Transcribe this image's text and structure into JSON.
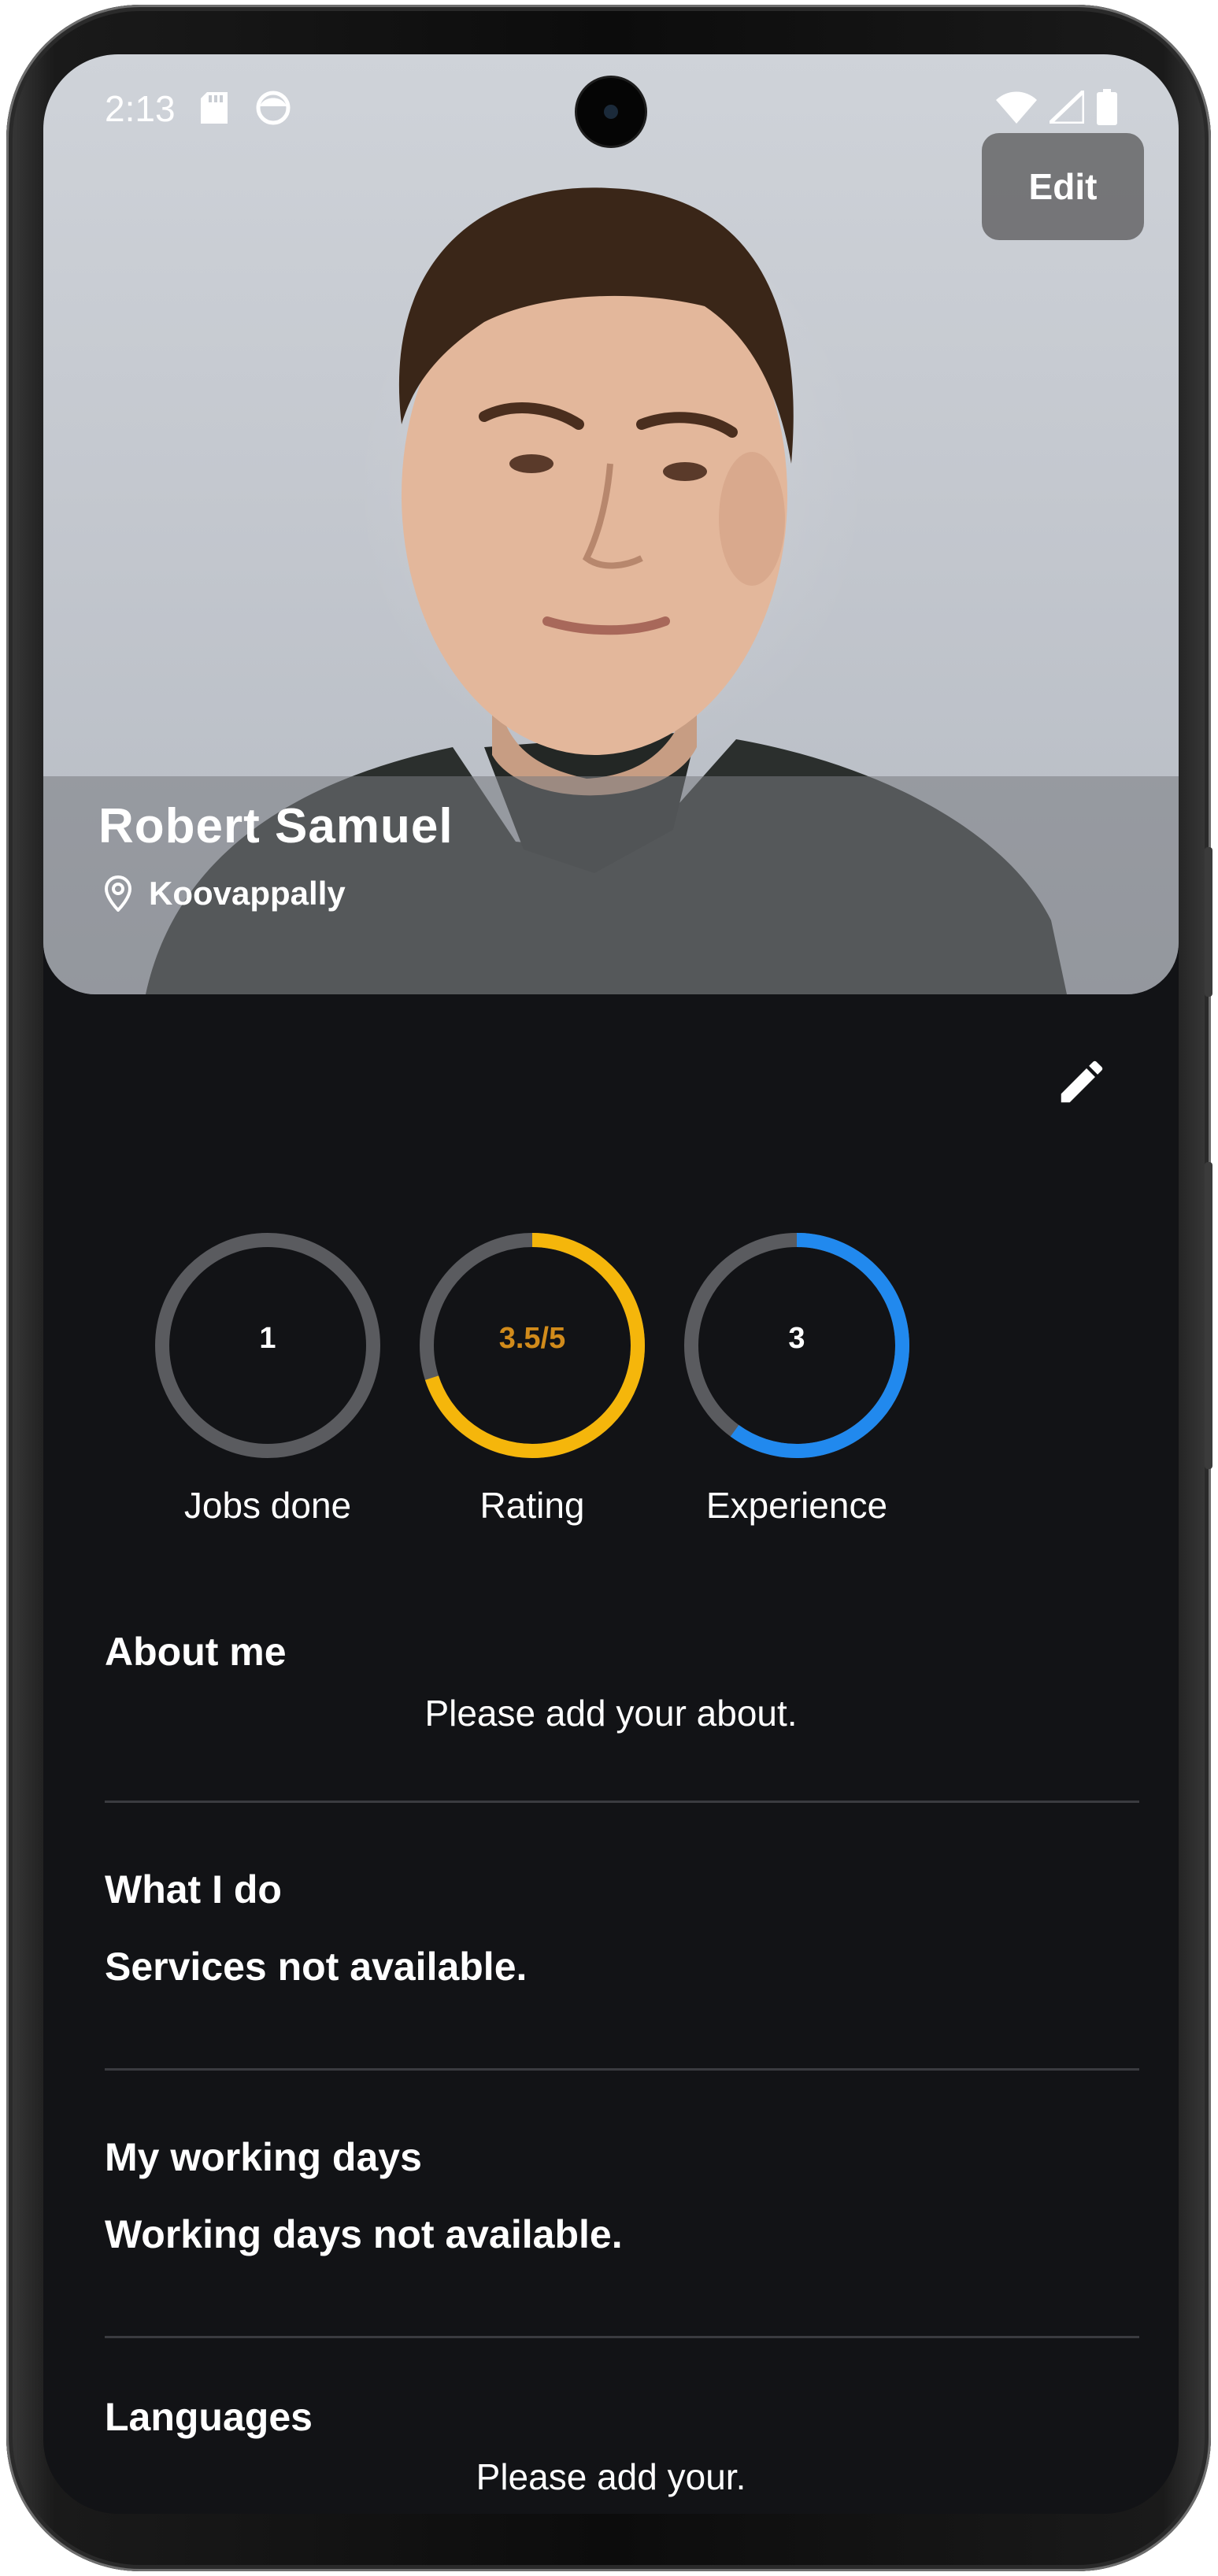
{
  "status_bar": {
    "time": "2:13",
    "icons": [
      "sd-card-icon",
      "face-icon",
      "wifi-icon",
      "signal-icon",
      "battery-icon"
    ]
  },
  "header": {
    "edit_label": "Edit",
    "name": "Robert Samuel",
    "location": "Koovappally",
    "icons": [
      "location-pin-icon",
      "pencil-icon"
    ]
  },
  "stats": [
    {
      "value": "1",
      "label": "Jobs done",
      "progress": 0.0,
      "ring_color": "#5a5b5f"
    },
    {
      "value": "3.5/5",
      "label": "Rating",
      "progress": 0.7,
      "ring_color": "#f5b60b",
      "value_color": "#d18b1b"
    },
    {
      "value": "3",
      "label": "Experience",
      "progress": 0.6,
      "ring_color": "#2189ee"
    }
  ],
  "sections": {
    "about_title": "About me",
    "about_body": "Please add your about.",
    "whatido_title": "What I do",
    "whatido_body": "Services not available.",
    "workdays_title": "My working days",
    "workdays_body": "Working days not available.",
    "languages_title": "Languages",
    "languages_body": "Please add your."
  },
  "colors": {
    "background": "#121316",
    "track": "#5a5b5f",
    "rating": "#f5b60b",
    "experience": "#2189ee"
  }
}
